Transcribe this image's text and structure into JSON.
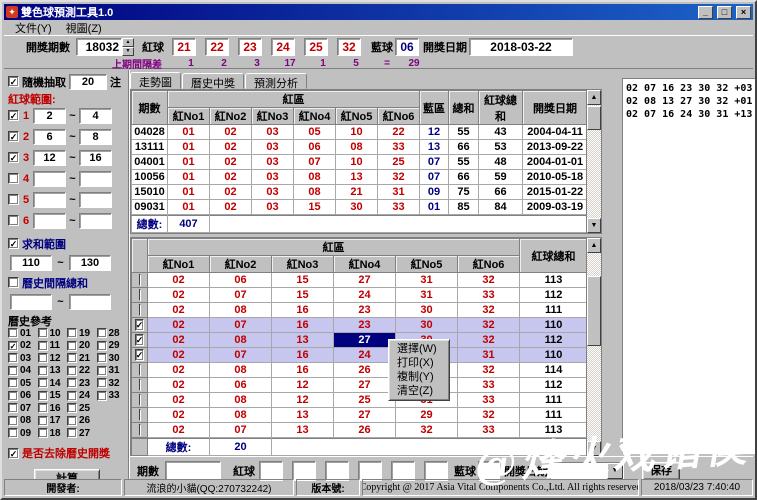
{
  "colors": {
    "red": "#c00000",
    "blue": "#000080",
    "purple": "#800080",
    "row_highlight": "#c6c6ee",
    "selection": "#000080",
    "titlebar": "#000080"
  },
  "icons": {
    "app": "✦",
    "check": "✓",
    "spinner_up": "▲",
    "spinner_down": "▼",
    "combo_arrow": "▼",
    "scroll_up": "▲",
    "scroll_down": "▼"
  },
  "window": {
    "title": "雙色球預測工具1.0",
    "minimize": "_",
    "maximize": "□",
    "close": "×"
  },
  "menu": {
    "items": [
      {
        "label": "文件(Y)"
      },
      {
        "label": "視圖(Z)"
      }
    ]
  },
  "toolbar": {
    "issue_label": "開獎期數",
    "issue_value": "18032",
    "red_label": "紅球",
    "red_balls": [
      "21",
      "22",
      "23",
      "24",
      "25",
      "32"
    ],
    "blue_label": "藍球",
    "blue_ball": "06",
    "date_label": "開獎日期",
    "date_value": "2018-03-22",
    "gap_label": "上期間隔差",
    "gaps": [
      "1",
      "2",
      "3",
      "17",
      "1",
      "5"
    ],
    "equals_sign": "=",
    "gap_total": "29"
  },
  "sidebar": {
    "random_label": "隨機抽取",
    "random_checked": true,
    "random_value": "20",
    "random_unit": "注",
    "red_range_label": "紅球範圍:",
    "tilde": "~",
    "ranges": [
      {
        "no": "1",
        "checked": true,
        "from": "2",
        "to": "4"
      },
      {
        "no": "2",
        "checked": true,
        "from": "6",
        "to": "8"
      },
      {
        "no": "3",
        "checked": true,
        "from": "12",
        "to": "16"
      },
      {
        "no": "4",
        "checked": false,
        "from": "",
        "to": ""
      },
      {
        "no": "5",
        "checked": false,
        "from": "",
        "to": ""
      },
      {
        "no": "6",
        "checked": false,
        "from": "",
        "to": ""
      }
    ],
    "sum_range_label": "求和範圍",
    "sum_checked": true,
    "sum_from": "110",
    "sum_to": "130",
    "hist_gap_label": "曆史間隔總和",
    "hist_gap_checked": false,
    "hist_gap_from": "",
    "hist_gap_to": "",
    "history_label": "曆史參考",
    "history_checked": [
      "02"
    ],
    "history_grid": [
      [
        "01",
        "10",
        "19",
        "28"
      ],
      [
        "02",
        "11",
        "20",
        "29"
      ],
      [
        "03",
        "12",
        "21",
        "30"
      ],
      [
        "04",
        "13",
        "22",
        "31"
      ],
      [
        "05",
        "14",
        "23",
        "32"
      ],
      [
        "06",
        "15",
        "24",
        "33"
      ],
      [
        "07",
        "16",
        "25",
        ""
      ],
      [
        "08",
        "17",
        "26",
        ""
      ],
      [
        "09",
        "18",
        "27",
        ""
      ]
    ],
    "remove_label": "是否去除曆史開獎",
    "remove_checked": true,
    "calc_button": "計算"
  },
  "tabs": {
    "items": [
      {
        "label": "走勢圖",
        "active": true
      },
      {
        "label": "曆史中獎",
        "active": false
      },
      {
        "label": "預測分析",
        "active": false
      }
    ]
  },
  "top_table": {
    "issue_col": "期數",
    "red_zone": "紅區",
    "red_cols": [
      "紅No1",
      "紅No2",
      "紅No3",
      "紅No4",
      "紅No5",
      "紅No6"
    ],
    "blue_col": "藍區",
    "sum_col": "總和",
    "red_sum_col": "紅球總和",
    "date_col": "開獎日期",
    "rows": [
      {
        "issue": "04028",
        "reds": [
          "01",
          "02",
          "03",
          "05",
          "10",
          "22"
        ],
        "blue": "12",
        "sum": "55",
        "red_sum": "43",
        "date": "2004-04-11"
      },
      {
        "issue": "13111",
        "reds": [
          "01",
          "02",
          "03",
          "06",
          "08",
          "33"
        ],
        "blue": "13",
        "sum": "66",
        "red_sum": "53",
        "date": "2013-09-22"
      },
      {
        "issue": "04001",
        "reds": [
          "01",
          "02",
          "03",
          "07",
          "10",
          "25"
        ],
        "blue": "07",
        "sum": "55",
        "red_sum": "48",
        "date": "2004-01-01"
      },
      {
        "issue": "10056",
        "reds": [
          "01",
          "02",
          "03",
          "08",
          "13",
          "32"
        ],
        "blue": "07",
        "sum": "66",
        "red_sum": "59",
        "date": "2010-05-18"
      },
      {
        "issue": "15010",
        "reds": [
          "01",
          "02",
          "03",
          "08",
          "21",
          "31"
        ],
        "blue": "09",
        "sum": "75",
        "red_sum": "66",
        "date": "2015-01-22"
      },
      {
        "issue": "09031",
        "reds": [
          "01",
          "02",
          "03",
          "15",
          "30",
          "33"
        ],
        "blue": "01",
        "sum": "85",
        "red_sum": "84",
        "date": "2009-03-19"
      }
    ],
    "total_label": "總數:",
    "total_value": "407"
  },
  "bottom_table": {
    "red_zone": "紅區",
    "red_cols": [
      "紅No1",
      "紅No2",
      "紅No3",
      "紅No4",
      "紅No5",
      "紅No6"
    ],
    "red_sum_col": "紅球總和",
    "rows": [
      {
        "checked": false,
        "highlight": false,
        "reds": [
          "02",
          "06",
          "15",
          "27",
          "31",
          "32"
        ],
        "red_sum": "113"
      },
      {
        "checked": false,
        "highlight": false,
        "reds": [
          "02",
          "07",
          "15",
          "24",
          "31",
          "33"
        ],
        "red_sum": "112"
      },
      {
        "checked": false,
        "highlight": false,
        "reds": [
          "02",
          "08",
          "16",
          "23",
          "30",
          "32"
        ],
        "red_sum": "111"
      },
      {
        "checked": true,
        "highlight": true,
        "reds": [
          "02",
          "07",
          "16",
          "23",
          "30",
          "32"
        ],
        "red_sum": "110"
      },
      {
        "checked": true,
        "highlight": true,
        "reds": [
          "02",
          "08",
          "13",
          "27",
          "30",
          "32"
        ],
        "red_sum": "112"
      },
      {
        "checked": true,
        "highlight": true,
        "reds": [
          "02",
          "07",
          "16",
          "24",
          "30",
          "31"
        ],
        "red_sum": "110"
      },
      {
        "checked": false,
        "highlight": false,
        "reds": [
          "02",
          "08",
          "16",
          "26",
          "30",
          "32"
        ],
        "red_sum": "114"
      },
      {
        "checked": false,
        "highlight": false,
        "reds": [
          "02",
          "06",
          "12",
          "27",
          "32",
          "33"
        ],
        "red_sum": "112"
      },
      {
        "checked": false,
        "highlight": false,
        "reds": [
          "02",
          "08",
          "12",
          "25",
          "31",
          "33"
        ],
        "red_sum": "111"
      },
      {
        "checked": false,
        "highlight": false,
        "reds": [
          "02",
          "08",
          "13",
          "27",
          "29",
          "32"
        ],
        "red_sum": "111"
      },
      {
        "checked": false,
        "highlight": false,
        "reds": [
          "02",
          "07",
          "13",
          "26",
          "32",
          "33"
        ],
        "red_sum": "113"
      }
    ],
    "selected_cell": {
      "row": 4,
      "col": 3
    },
    "total_label": "總數:",
    "total_value": "20"
  },
  "context_menu": {
    "items": [
      "選擇(W)",
      "打印(X)",
      "複制(Y)",
      "清空(Z)"
    ]
  },
  "results_panel": {
    "lines": [
      "02 07 16 23 30 32 +03",
      "02 08 13 27 30 32 +01",
      "02 07 16 24 30 31 +13"
    ]
  },
  "bottom_bar": {
    "issue_label": "期數",
    "issue_value": "",
    "red_label": "紅球",
    "red_inputs": [
      "",
      "",
      "",
      "",
      "",
      ""
    ],
    "blue_label": "藍球",
    "blue_input": "",
    "date_label": "開獎日期",
    "date_value": "",
    "save_button": "保存"
  },
  "status_bar": {
    "dev_label": "開發者:",
    "dev_value": "流浪的小貓(QQ:270732242)",
    "version_label": "版本號:",
    "version_value": "",
    "copyright": "Copyright @ 2017 Asia Vital Components Co.,Ltd. All rights reserved",
    "timestamp": "2018/03/23 7:40:40"
  },
  "watermark": "@烽火戏诸侯"
}
